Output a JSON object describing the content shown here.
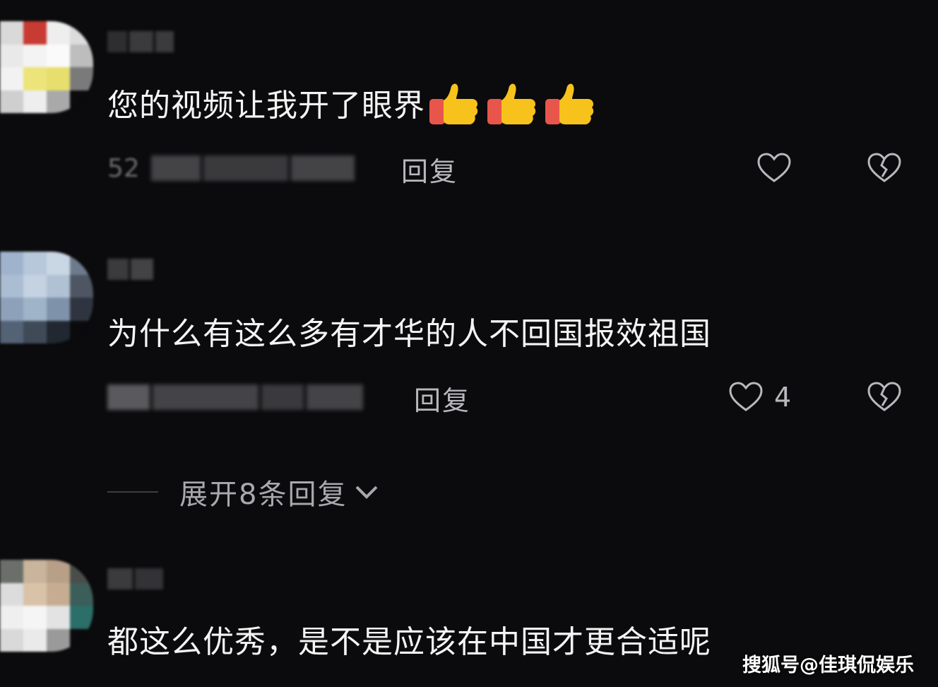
{
  "comments": [
    {
      "text": "您的视频让我开了眼界",
      "emoji": [
        "thumbs-up-icon",
        "thumbs-up-icon",
        "thumbs-up-icon"
      ],
      "meta_visible": "52",
      "reply_label": "回复",
      "like_count": ""
    },
    {
      "text": "为什么有这么多有才华的人不回国报效祖国",
      "reply_label": "回复",
      "like_count": "4"
    },
    {
      "text": "都这么优秀，是不是应该在中国才更合适呢"
    }
  ],
  "expand_replies": {
    "label": "展开8条回复",
    "icon": "chevron-down-icon"
  },
  "watermark": "搜狐号@佳琪侃娱乐",
  "colors": {
    "background": "#0b0b0d",
    "text": "#f4f4f4",
    "secondary": "#b8b8bc",
    "thumb_yellow": "#f7c21c",
    "thumb_red": "#e8564b"
  }
}
